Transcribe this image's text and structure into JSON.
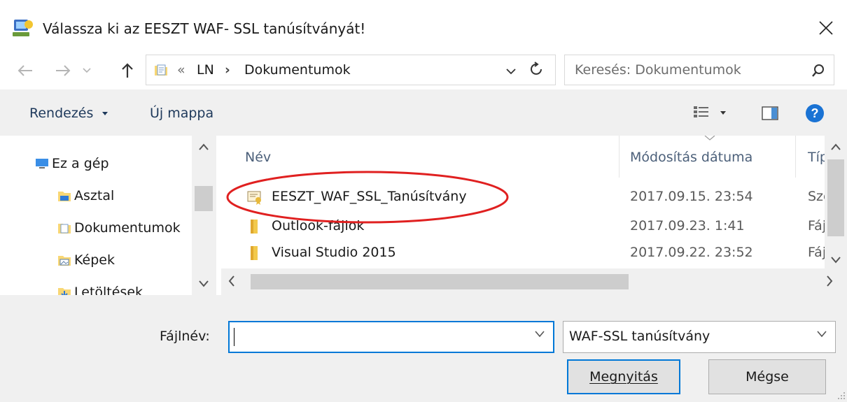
{
  "window": {
    "title": "Válassza ki az EESZT WAF- SSL tanúsítványát!",
    "close_label": "✕"
  },
  "navigation": {
    "back_icon": "arrow-left-icon",
    "forward_icon": "arrow-right-icon",
    "recent_icon": "chevron-down-icon",
    "up_icon": "arrow-up-icon",
    "breadcrumb": {
      "overflow": "«",
      "items": [
        "LN",
        "Dokumentumok"
      ],
      "separator": "›"
    },
    "refresh_icon": "refresh-icon",
    "search": {
      "placeholder": "Keresés: Dokumentumok"
    }
  },
  "toolbar": {
    "organize_label": "Rendezés",
    "new_folder_label": "Új mappa"
  },
  "nav_pane": {
    "items": [
      {
        "label": "Ez a gép",
        "icon": "computer-icon"
      },
      {
        "label": "Asztal",
        "icon": "desktop-icon"
      },
      {
        "label": "Dokumentumok",
        "icon": "documents-icon"
      },
      {
        "label": "Képek",
        "icon": "pictures-icon"
      },
      {
        "label": "Letöltések",
        "icon": "downloads-icon"
      }
    ]
  },
  "file_list": {
    "columns": [
      "Név",
      "Módosítás dátuma",
      "Típ"
    ],
    "rows": [
      {
        "name": "EESZT_WAF_SSL_Tanúsítvány",
        "date": "2017.09.15. 23:54",
        "type": "Sze",
        "icon": "certificate-icon"
      },
      {
        "name": "Outlook-fájlok",
        "date": "2017.09.23. 1:41",
        "type": "Fájl",
        "icon": "folder-icon"
      },
      {
        "name": "Visual Studio 2015",
        "date": "2017.09.22. 23:52",
        "type": "Fájl",
        "icon": "folder-icon"
      }
    ]
  },
  "footer": {
    "filename_label": "Fájlnév:",
    "filename_value": "",
    "filter_value": "WAF-SSL tanúsítvány",
    "open_button": "Megnyitás",
    "cancel_button": "Mégse"
  },
  "colors": {
    "accent": "#0078d7",
    "highlight_ellipse": "#e02020",
    "toolbar_bg": "#f0f0f0"
  }
}
